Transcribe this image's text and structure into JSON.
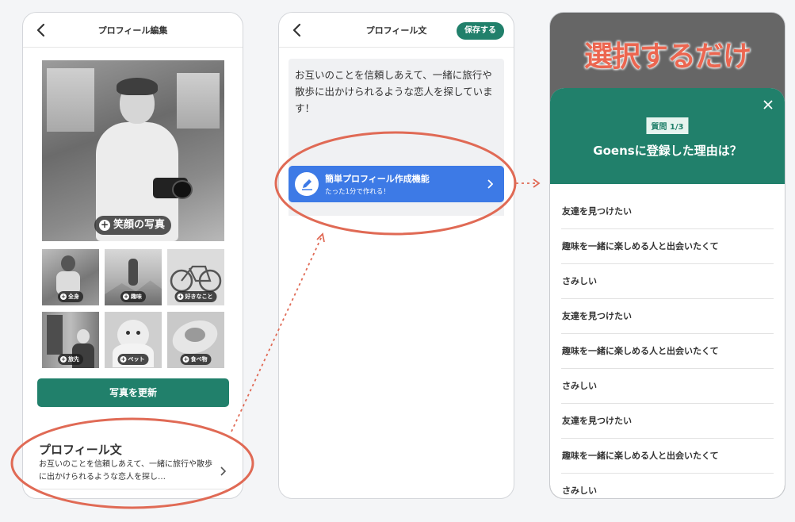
{
  "screen1": {
    "title": "プロフィール編集",
    "main_photo_label": "笑顔の写真",
    "thumbnails": [
      {
        "label": "全身"
      },
      {
        "label": "趣味"
      },
      {
        "label": "好きなこと"
      },
      {
        "label": "旅先"
      },
      {
        "label": "ペット"
      },
      {
        "label": "食べ物"
      }
    ],
    "update_button": "写真を更新",
    "profile_heading": "プロフィール文",
    "profile_preview": "お互いのことを信頼しあえて、一緒に旅行や散歩に出かけられるような恋人を探し…"
  },
  "screen2": {
    "title": "プロフィール文",
    "save_button": "保存する",
    "profile_text": "お互いのことを信頼しあえて、一緒に旅行や散歩に出かけられるような恋人を探しています！",
    "easy_button_title": "簡単プロフィール作成機能",
    "easy_button_sub": "たった1分で作れる！"
  },
  "screen3": {
    "caption": "選択するだけ",
    "question_badge": "質問 1/3",
    "question_title": "Goensに登録した理由は？",
    "answers": [
      "友達を見つけたい",
      "趣味を一緒に楽しめる人と出会いたくて",
      "さみしい",
      "友達を見つけたい",
      "趣味を一緒に楽しめる人と出会いたくて",
      "さみしい",
      "友達を見つけたい",
      "趣味を一緒に楽しめる人と出会いたくて",
      "さみしい"
    ]
  },
  "colors": {
    "brand_green": "#21806b",
    "button_blue": "#3d7ae6",
    "highlight_red": "#e06a55",
    "overlay_gray": "#666666"
  },
  "icons": [
    "back-chevron-icon",
    "plus-circle-icon",
    "chevron-right-icon",
    "pencil-icon",
    "close-icon",
    "dotted-arrow-icon"
  ]
}
